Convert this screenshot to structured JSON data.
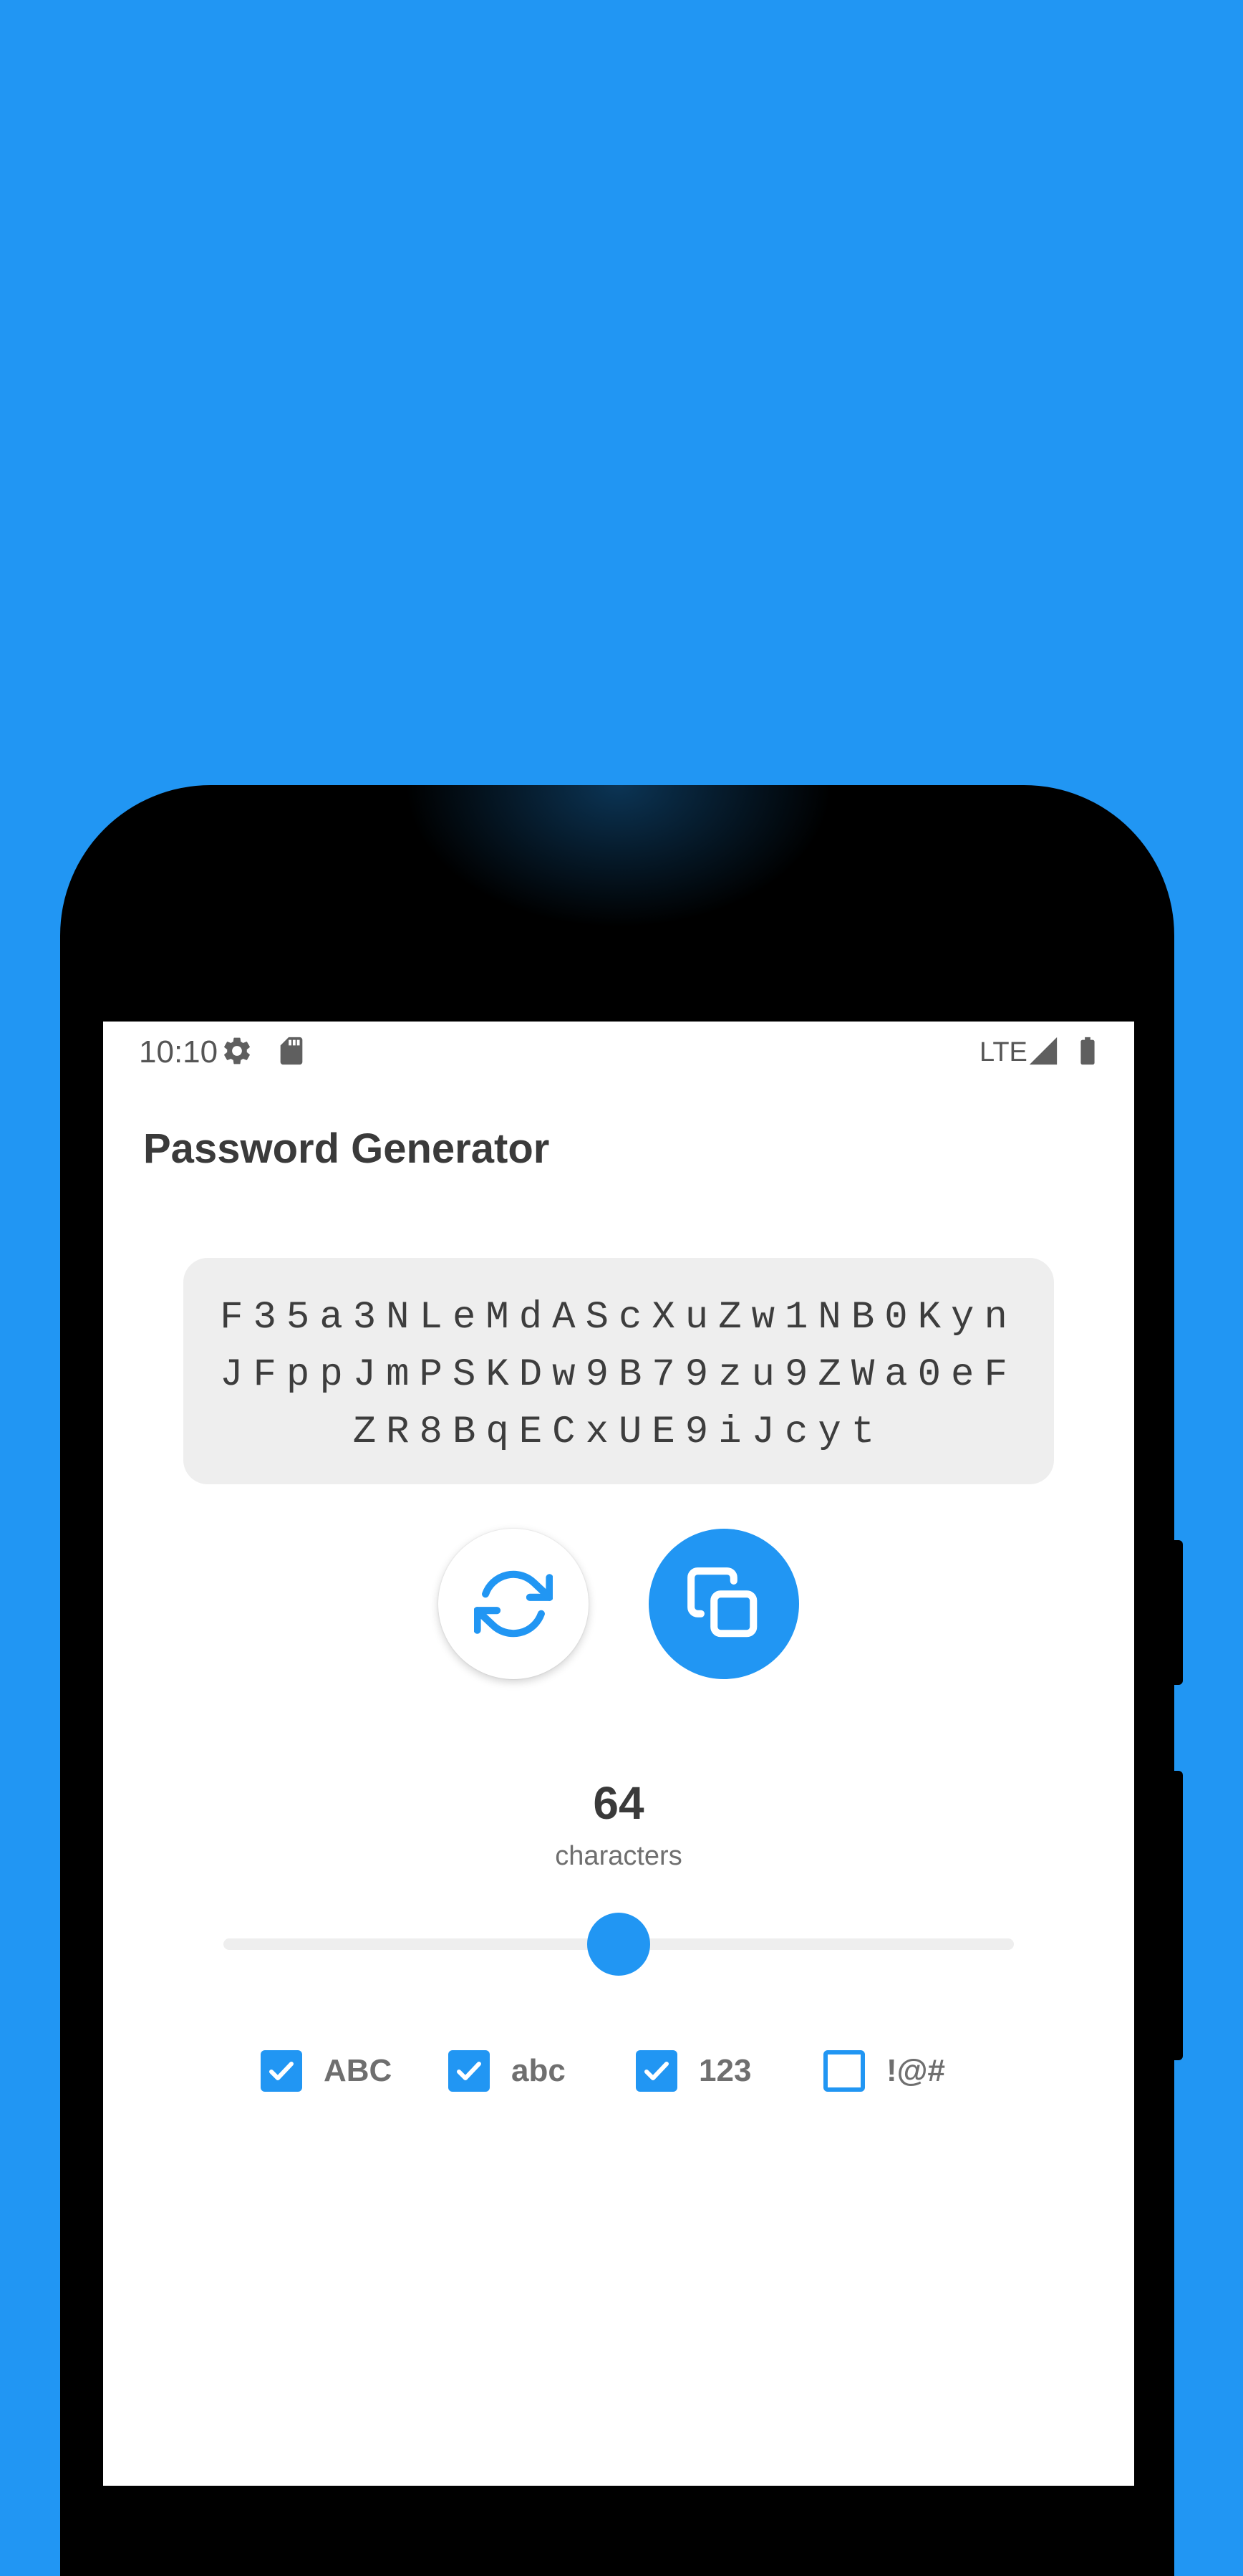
{
  "status_bar": {
    "time": "10:10",
    "network": "LTE",
    "icons": [
      "gear-icon",
      "sd-card-icon",
      "signal-icon",
      "battery-icon"
    ]
  },
  "app": {
    "title": "Password Generator"
  },
  "password": {
    "value": "F35a3NLeMdAScXuZw1NB0KynJFppJmPSKDw9B79zu9ZWa0eFZR8BqECxUE9iJcyt"
  },
  "actions": {
    "regenerate_icon": "refresh-icon",
    "copy_icon": "copy-icon"
  },
  "length": {
    "value": "64",
    "label": "characters",
    "slider_fraction": 0.5
  },
  "options": [
    {
      "label": "ABC",
      "checked": true
    },
    {
      "label": "abc",
      "checked": true
    },
    {
      "label": "123",
      "checked": true
    },
    {
      "label": "!@#",
      "checked": false
    }
  ],
  "colors": {
    "accent": "#2196F3",
    "background": "#2196F3",
    "password_box": "#EEEEEE",
    "title_text": "#3A3A3A"
  }
}
